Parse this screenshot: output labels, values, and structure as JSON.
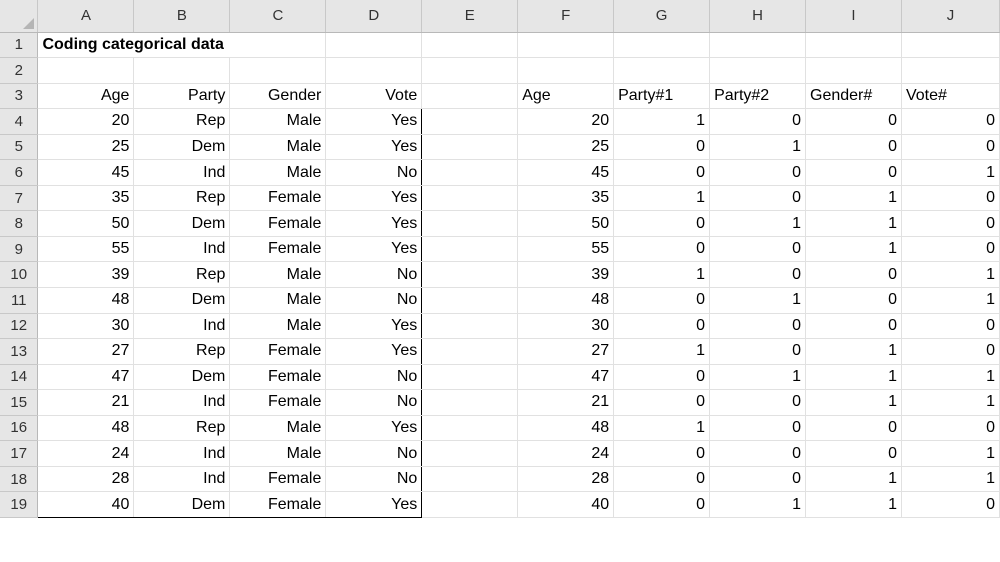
{
  "columns": [
    "A",
    "B",
    "C",
    "D",
    "E",
    "F",
    "G",
    "H",
    "I",
    "J"
  ],
  "title": "Coding categorical data",
  "left_headers": [
    "Age",
    "Party",
    "Gender",
    "Vote"
  ],
  "right_headers": [
    "Age",
    "Party#1",
    "Party#2",
    "Gender#",
    "Vote#"
  ],
  "raw_rows": [
    [
      "20",
      "Rep",
      "Male",
      "Yes"
    ],
    [
      "25",
      "Dem",
      "Male",
      "Yes"
    ],
    [
      "45",
      "Ind",
      "Male",
      "No"
    ],
    [
      "35",
      "Rep",
      "Female",
      "Yes"
    ],
    [
      "50",
      "Dem",
      "Female",
      "Yes"
    ],
    [
      "55",
      "Ind",
      "Female",
      "Yes"
    ],
    [
      "39",
      "Rep",
      "Male",
      "No"
    ],
    [
      "48",
      "Dem",
      "Male",
      "No"
    ],
    [
      "30",
      "Ind",
      "Male",
      "Yes"
    ],
    [
      "27",
      "Rep",
      "Female",
      "Yes"
    ],
    [
      "47",
      "Dem",
      "Female",
      "No"
    ],
    [
      "21",
      "Ind",
      "Female",
      "No"
    ],
    [
      "48",
      "Rep",
      "Male",
      "Yes"
    ],
    [
      "24",
      "Ind",
      "Male",
      "No"
    ],
    [
      "28",
      "Ind",
      "Female",
      "No"
    ],
    [
      "40",
      "Dem",
      "Female",
      "Yes"
    ]
  ],
  "coded_rows": [
    [
      "20",
      "1",
      "0",
      "0",
      "0"
    ],
    [
      "25",
      "0",
      "1",
      "0",
      "0"
    ],
    [
      "45",
      "0",
      "0",
      "0",
      "1"
    ],
    [
      "35",
      "1",
      "0",
      "1",
      "0"
    ],
    [
      "50",
      "0",
      "1",
      "1",
      "0"
    ],
    [
      "55",
      "0",
      "0",
      "1",
      "0"
    ],
    [
      "39",
      "1",
      "0",
      "0",
      "1"
    ],
    [
      "48",
      "0",
      "1",
      "0",
      "1"
    ],
    [
      "30",
      "0",
      "0",
      "0",
      "0"
    ],
    [
      "27",
      "1",
      "0",
      "1",
      "0"
    ],
    [
      "47",
      "0",
      "1",
      "1",
      "1"
    ],
    [
      "21",
      "0",
      "0",
      "1",
      "1"
    ],
    [
      "48",
      "1",
      "0",
      "0",
      "0"
    ],
    [
      "24",
      "0",
      "0",
      "0",
      "1"
    ],
    [
      "28",
      "0",
      "0",
      "1",
      "1"
    ],
    [
      "40",
      "0",
      "1",
      "1",
      "0"
    ]
  ]
}
